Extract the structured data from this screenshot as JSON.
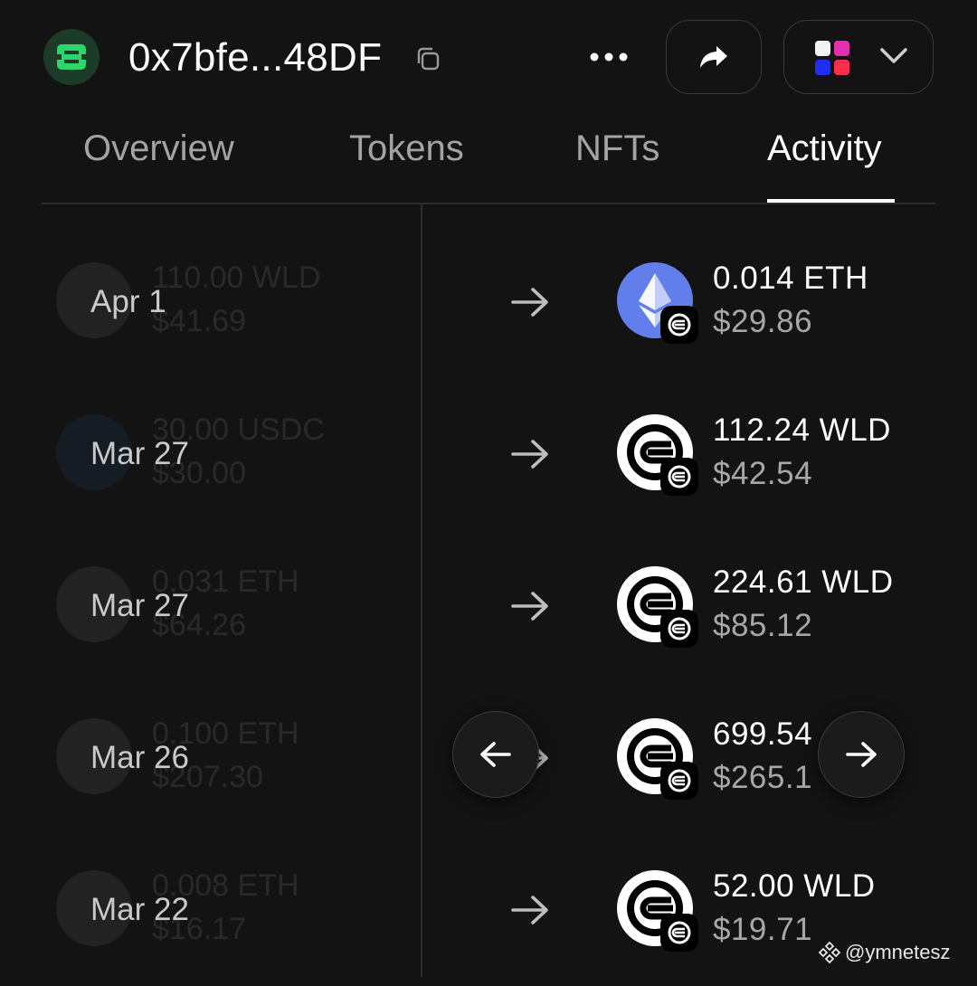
{
  "header": {
    "address": "0x7bfe...48DF",
    "icons": [
      "copy-icon",
      "more-icon",
      "share-icon",
      "chevron-down-icon"
    ]
  },
  "tabs": [
    {
      "label": "Overview",
      "active": false
    },
    {
      "label": "Tokens",
      "active": false
    },
    {
      "label": "NFTs",
      "active": false
    },
    {
      "label": "Activity",
      "active": true
    }
  ],
  "activity": [
    {
      "date": "Apr 1",
      "sent_amount": "110.00 WLD",
      "sent_usd": "$41.69",
      "received_amount": "0.014 ETH",
      "received_usd": "$29.86",
      "received_token": "ETH"
    },
    {
      "date": "Mar 27",
      "sent_amount": "30.00 USDC",
      "sent_usd": "$30.00",
      "received_amount": "112.24 WLD",
      "received_usd": "$42.54",
      "received_token": "WLD"
    },
    {
      "date": "Mar 27",
      "sent_amount": "0.031 ETH",
      "sent_usd": "$64.26",
      "received_amount": "224.61 WLD",
      "received_usd": "$85.12",
      "received_token": "WLD"
    },
    {
      "date": "Mar 26",
      "sent_amount": "0.100 ETH",
      "sent_usd": "$207.30",
      "received_amount": "699.54",
      "received_usd": "$265.1",
      "received_token": "WLD"
    },
    {
      "date": "Mar 22",
      "sent_amount": "0.008 ETH",
      "sent_usd": "$16.17",
      "received_amount": "52.00 WLD",
      "received_usd": "$19.71",
      "received_token": "WLD"
    }
  ],
  "watermark": "@ymnetesz",
  "colors": {
    "background": "#131313",
    "logo_green": "#2bd66a",
    "eth_blue": "#627eea",
    "muted_text": "#a7a7a7"
  }
}
